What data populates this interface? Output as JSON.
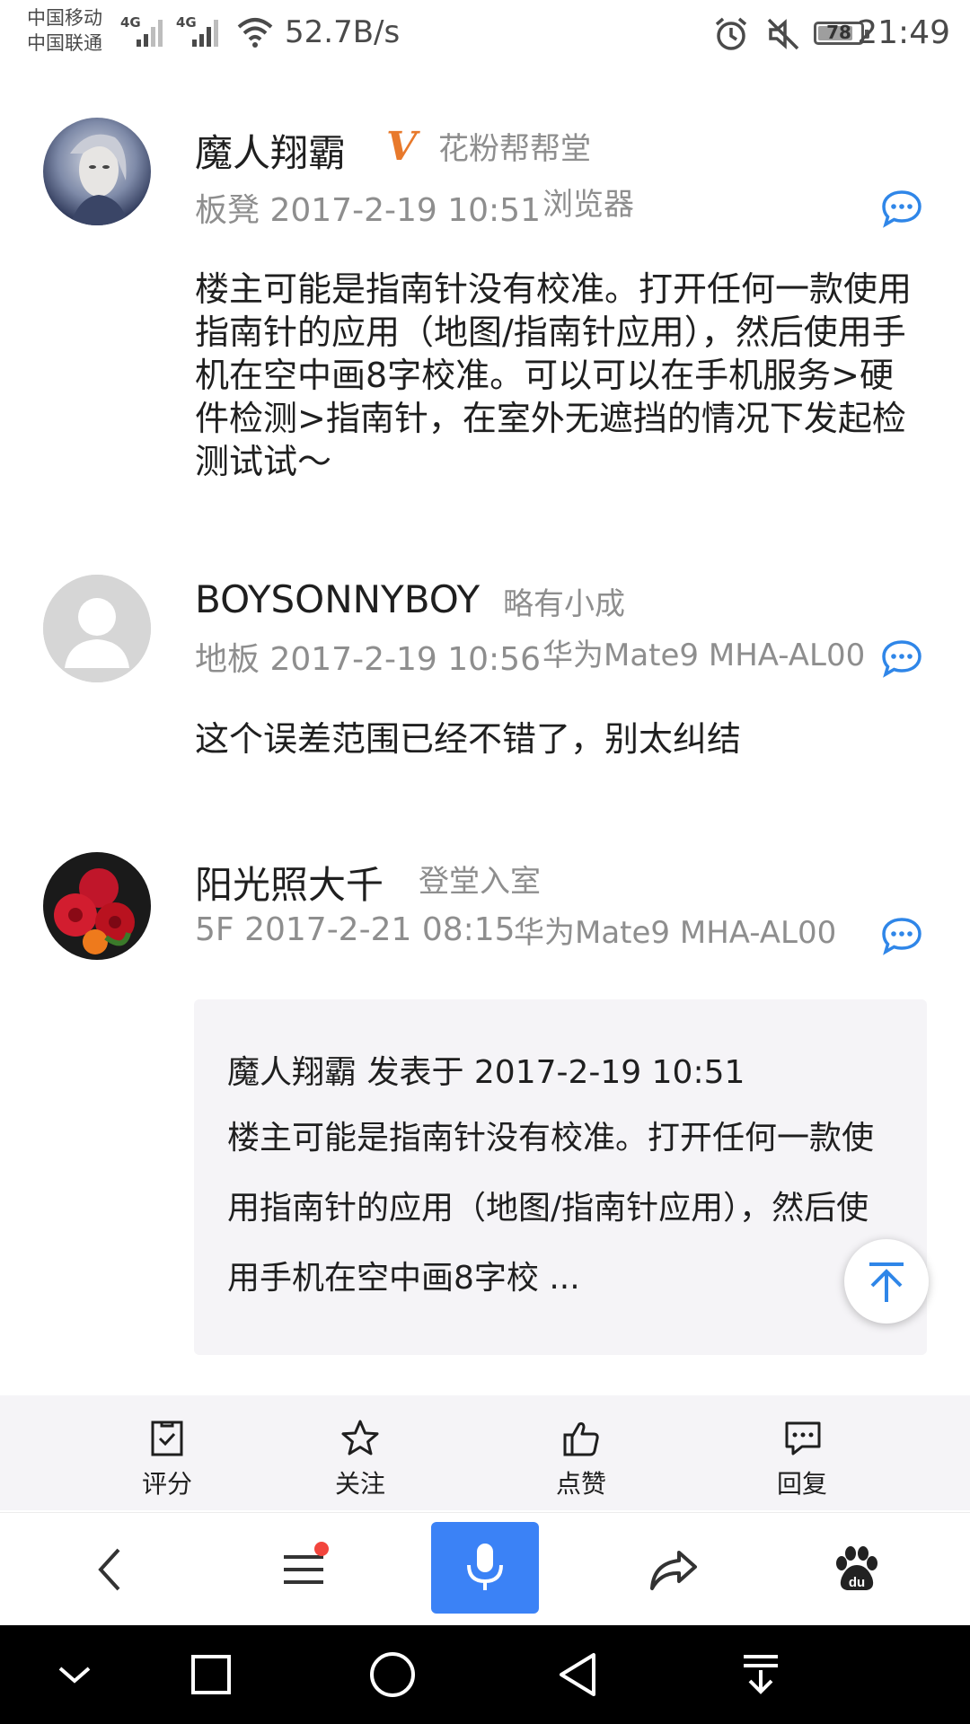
{
  "status_bar": {
    "carrier_1": "中国移动",
    "carrier_2": "中国联通",
    "network_1": "4G",
    "network_2": "4G",
    "net_speed": "52.7B/s",
    "battery": "78",
    "time": "21:49"
  },
  "posts": [
    {
      "username": "魔人翔霸",
      "vip_mark": "V",
      "rank": "花粉帮帮堂",
      "floor": "板凳",
      "datetime": "2017-2-19 10:51",
      "device": "浏览器",
      "content": "楼主可能是指南针没有校准。打开任何一款使用指南针的应用（地图/指南针应用），然后使用手机在空中画8字校准。可以可以在手机服务>硬件检测>指南针，在室外无遮挡的情况下发起检测试试～"
    },
    {
      "username": "BOYSONNYBOY",
      "rank": "略有小成",
      "floor": "地板",
      "datetime": "2017-2-19 10:56",
      "device": "华为Mate9 MHA-AL00",
      "content": "这个误差范围已经不错了，别太纠结"
    },
    {
      "username": "阳光照大千",
      "rank": "登堂入室",
      "floor": "5F",
      "datetime": "2017-2-21 08:15",
      "device": "华为Mate9 MHA-AL00",
      "quote": {
        "header": "魔人翔霸 发表于 2017-2-19 10:51",
        "text": "楼主可能是指南针没有校准。打开任何一款使用指南针的应用（地图/指南针应用），然后使用手机在空中画8字校 ..."
      }
    }
  ],
  "action_bar": {
    "rate": "评分",
    "follow": "关注",
    "like": "点赞",
    "reply": "回复"
  },
  "colors": {
    "accent_blue": "#3b82f6",
    "vip_orange": "#e8792b",
    "notification_red": "#f2453d",
    "quote_bg": "#f5f4f7"
  },
  "icons": [
    "back-icon",
    "menu-icon",
    "microphone-icon",
    "share-icon",
    "baidu-paw-icon",
    "comment-bubble-icon",
    "back-to-top-icon"
  ]
}
